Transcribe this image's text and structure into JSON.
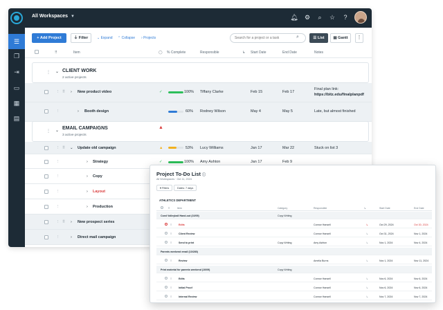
{
  "topbar": {
    "workspace": "All Workspaces"
  },
  "toolbar": {
    "add_project": "+ Add Project",
    "filter": "Filter",
    "expand": "Expand",
    "collapse": "Collapse",
    "projects": "Projects",
    "search_placeholder": "Search for a project or a task",
    "list": "List",
    "gantt": "Gantt"
  },
  "columns": {
    "item": "Item",
    "complete": "% Complete",
    "responsible": "Responsible",
    "start": "Start Date",
    "end": "End Date",
    "notes": "Notes"
  },
  "groups": [
    {
      "title": "CLIENT WORK",
      "sub": "2 active projects"
    },
    {
      "title": "EMAIL CAMPAIGNS",
      "sub": "3 active projects"
    }
  ],
  "rows": [
    {
      "name": "New product video",
      "pct": "100%",
      "fill": 1.0,
      "color": "#2dbf5a",
      "resp": "Tiffany Clarke",
      "start": "Feb 15",
      "end": "Feb 17",
      "notes": "Final plan link:",
      "notes2": "https://bitz.edu/finalplanpdf"
    },
    {
      "name": "Booth design",
      "pct": "60%",
      "fill": 0.6,
      "color": "#2f7bd6",
      "resp": "Rodney Wilson",
      "start": "May 4",
      "end": "May 5",
      "notes": "Late, but almost finished"
    },
    {
      "name": "Update old campaign",
      "pct": "53%",
      "fill": 0.53,
      "color": "#f2b01e",
      "resp": "Lucy Williams",
      "start": "Jan 17",
      "end": "Mar 22",
      "notes": "Stuck on list 3"
    },
    {
      "name": "Strategy",
      "pct": "100%",
      "fill": 1.0,
      "color": "#2dbf5a",
      "resp": "Amy Ashton",
      "start": "Jan 17",
      "end": "Feb 9"
    },
    {
      "name": "Copy"
    },
    {
      "name": "Layout"
    },
    {
      "name": "Production"
    },
    {
      "name": "New prospect series"
    },
    {
      "name": "Direct mail campaign"
    }
  ],
  "overlay": {
    "title": "Project To-Do List",
    "subtitle": "All Workspaces · Oct 11, 2024",
    "chip1": "Filters",
    "chip2": "Dates: 7 days",
    "dept": "ATHLETICS DEPARTMENT",
    "cols": {
      "item": "Item",
      "category": "Category",
      "responsible": "Responsible",
      "start": "Start Date",
      "end": "End Date"
    },
    "rows": [
      {
        "item": "Coed Volleyball Hand-out (10/09)",
        "cat": "Copy Writing",
        "group": true
      },
      {
        "item": "Edits",
        "resp": "Connor Hansell",
        "start": "Oct 29, 2024",
        "end": "Oct 30, 2024",
        "red": true
      },
      {
        "item": "Client Review",
        "resp": "Connor Hansell",
        "start": "Oct 31, 2024",
        "end": "Nov 1, 2024"
      },
      {
        "item": "Send to print",
        "cat": "Copy Writing",
        "resp": "Amy Ashton",
        "start": "Nov 1, 2024",
        "end": "Nov 4, 2024"
      },
      {
        "item": "Parents weekend email (10/280)",
        "group": true
      },
      {
        "item": "Review",
        "resp": "Amelia Burns",
        "start": "Nov 1, 2024",
        "end": "Nov 11, 2024"
      },
      {
        "item": "Print material for parents weekend (10/09)",
        "cat": "Copy Writing",
        "group": true
      },
      {
        "item": "Edits",
        "resp": "Connor Hansell",
        "start": "Nov 6, 2024",
        "end": "Nov 6, 2024"
      },
      {
        "item": "Initial Proof",
        "resp": "Connor Hansell",
        "start": "Nov 6, 2024",
        "end": "Nov 6, 2024"
      },
      {
        "item": "Internal Review",
        "resp": "Connor Hansell",
        "start": "Nov 7, 2024",
        "end": "Nov 7, 2024"
      }
    ]
  }
}
